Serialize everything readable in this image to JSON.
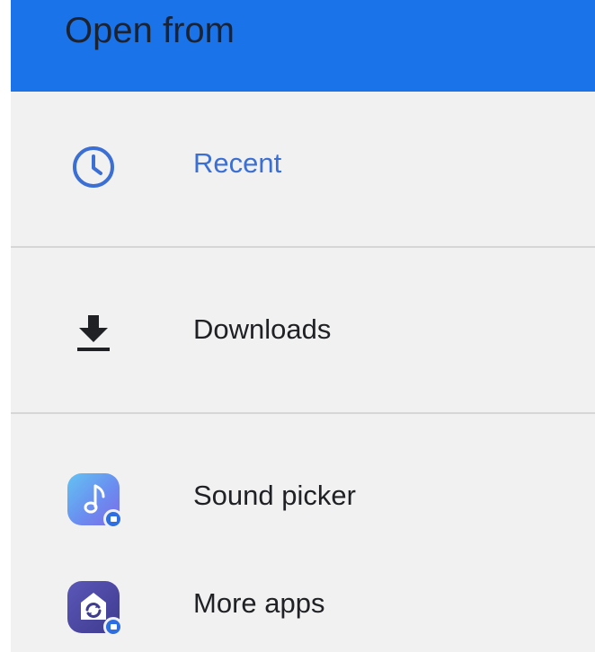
{
  "header": {
    "title": "Open from"
  },
  "items": [
    {
      "label": "Recent",
      "icon": "clock-icon",
      "selected": true
    },
    {
      "label": "Downloads",
      "icon": "download-icon",
      "selected": false
    },
    {
      "label": "Sound picker",
      "icon": "sound-picker-app-icon",
      "selected": false
    },
    {
      "label": "More apps",
      "icon": "more-apps-app-icon",
      "selected": false
    }
  ],
  "colors": {
    "header_bg": "#1a73e8",
    "accent": "#3b6fd4",
    "background": "#f1f1f1",
    "divider": "#d6d6d6"
  }
}
